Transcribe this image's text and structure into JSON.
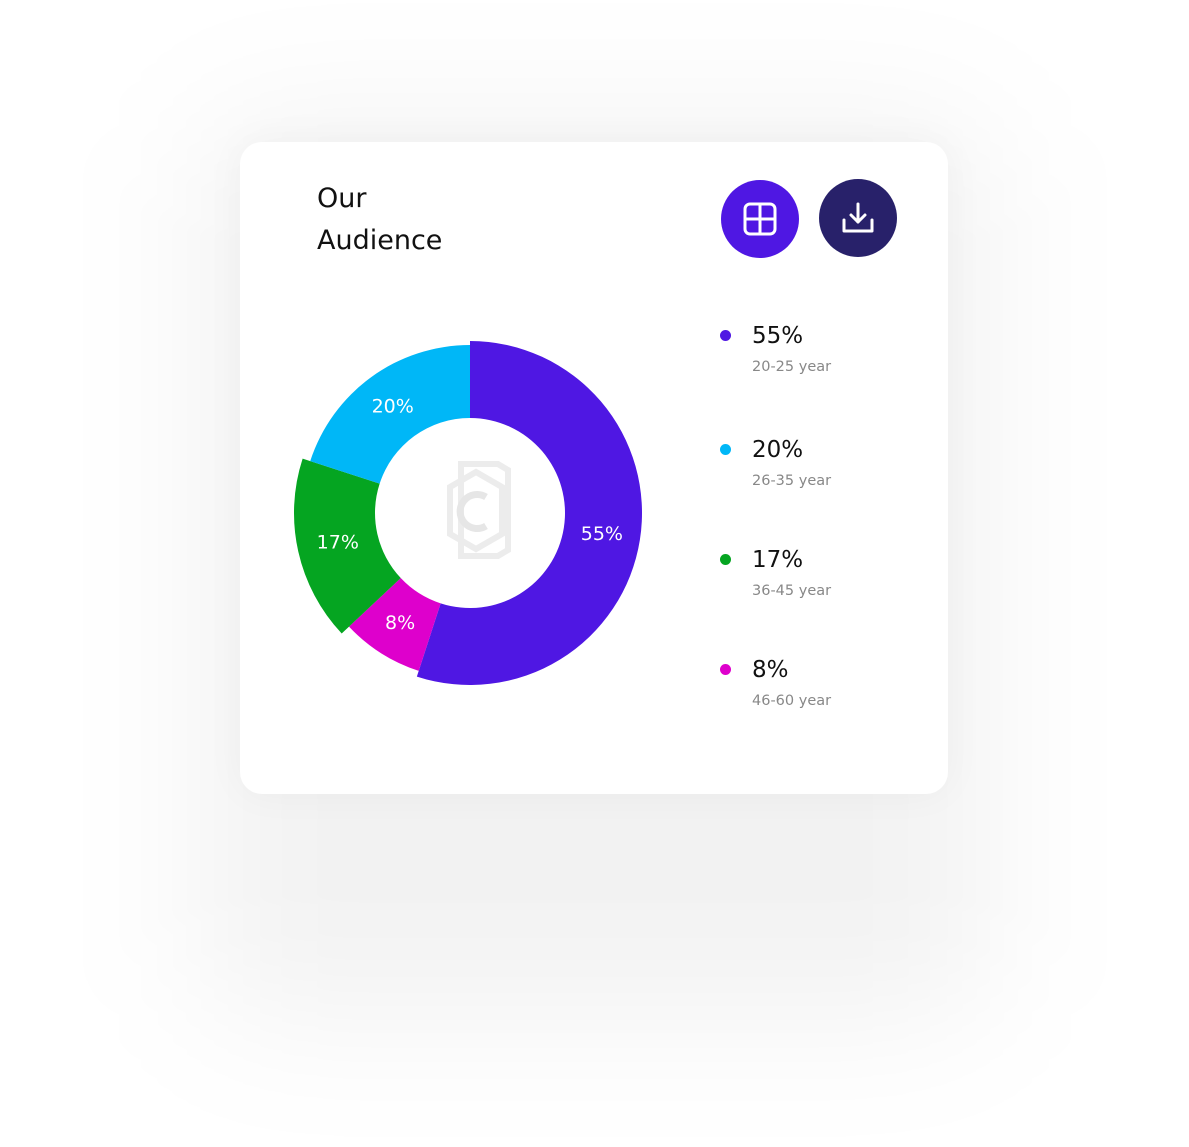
{
  "card": {
    "title": "Our\nAudience"
  },
  "toolbar": {
    "grid_icon": "grid-icon",
    "download_icon": "download-icon"
  },
  "colors": {
    "purple": "#4F17E3",
    "navy": "#28216A",
    "cyan": "#00B7F7",
    "green": "#05A521",
    "magenta": "#DE00CC"
  },
  "chart_data": {
    "type": "pie",
    "variant": "donut",
    "title": "Our Audience",
    "categories": [
      "20-25 year",
      "26-35 year",
      "36-45 year",
      "46-60 year"
    ],
    "values": [
      55,
      20,
      17,
      8
    ],
    "labels": [
      "55%",
      "20%",
      "17%",
      "8%"
    ],
    "colors": [
      "#4F17E3",
      "#00B7F7",
      "#05A521",
      "#DE00CC"
    ],
    "legend_position": "right"
  },
  "legend": {
    "items": [
      {
        "value": "55%",
        "range": "20-25 year",
        "color": "#4F17E3"
      },
      {
        "value": "20%",
        "range": "26-35 year",
        "color": "#00B7F7"
      },
      {
        "value": "17%",
        "range": "36-45 year",
        "color": "#05A521"
      },
      {
        "value": "8%",
        "range": "46-60 year",
        "color": "#DE00CC"
      }
    ]
  }
}
